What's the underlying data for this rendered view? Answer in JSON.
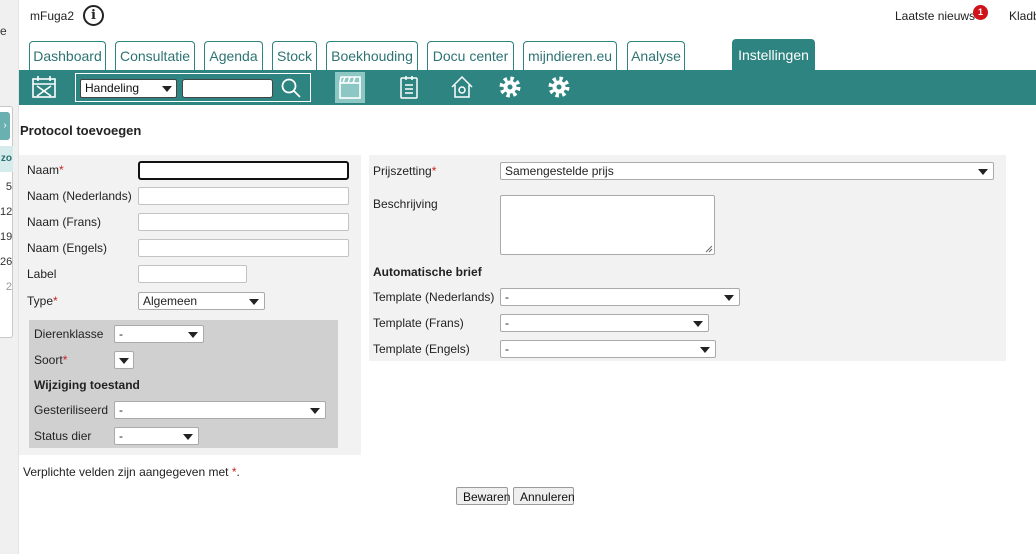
{
  "app": {
    "title": "mFuga2",
    "info_icon": "info-icon",
    "news_label": "Laatste nieuws",
    "news_count": "1",
    "kladblok_label": "Kladblok"
  },
  "left_strip": {
    "edge_char": "e",
    "arrow_glyph": "›",
    "head": "zo",
    "numbers": [
      "5",
      "12",
      "19",
      "26",
      "2"
    ]
  },
  "tabs": [
    {
      "label": "Dashboard"
    },
    {
      "label": "Consultatie"
    },
    {
      "label": "Agenda"
    },
    {
      "label": "Stock"
    },
    {
      "label": "Boekhouding"
    },
    {
      "label": "Docu center"
    },
    {
      "label": "mijndieren.eu"
    },
    {
      "label": "Analyse"
    },
    {
      "label": "Instellingen",
      "active": true
    }
  ],
  "toolbar": {
    "search_type": "Handeling",
    "search_value": "",
    "icons": [
      "calendar-x-icon",
      "search-icon",
      "clapperboard-icon",
      "clipboard-icon",
      "house-icon",
      "gear-icon",
      "gear-icon"
    ]
  },
  "page": {
    "title": "Protocol toevoegen"
  },
  "form": {
    "naam_label": "Naam",
    "naam_nl_label": "Naam (Nederlands)",
    "naam_fr_label": "Naam (Frans)",
    "naam_en_label": "Naam (Engels)",
    "label_label": "Label",
    "type_label": "Type",
    "type_value": "Algemeen",
    "dierenklasse_label": "Dierenklasse",
    "dierenklasse_value": "-",
    "soort_label": "Soort",
    "soort_value": "",
    "wijziging_heading": "Wijziging toestand",
    "gesteriliseerd_label": "Gesteriliseerd",
    "gesteriliseerd_value": "-",
    "status_label": "Status dier",
    "status_value": "-",
    "prijszetting_label": "Prijszetting",
    "prijszetting_value": "Samengestelde prijs",
    "beschrijving_label": "Beschrijving",
    "beschrijving_value": "",
    "auto_brief_heading": "Automatische brief",
    "template_nl_label": "Template (Nederlands)",
    "template_nl_value": "-",
    "template_fr_label": "Template (Frans)",
    "template_fr_value": "-",
    "template_en_label": "Template (Engels)",
    "template_en_value": "-",
    "required_mark": "*"
  },
  "footer": {
    "note_text": "Verplichte velden zijn aangegeven met",
    "note_mark": "*",
    "note_end": ".",
    "save_label": "Bewaren",
    "cancel_label": "Annuleren"
  },
  "colors": {
    "accent": "#2e8480",
    "required": "#cc2222",
    "badge": "#d0121b"
  }
}
